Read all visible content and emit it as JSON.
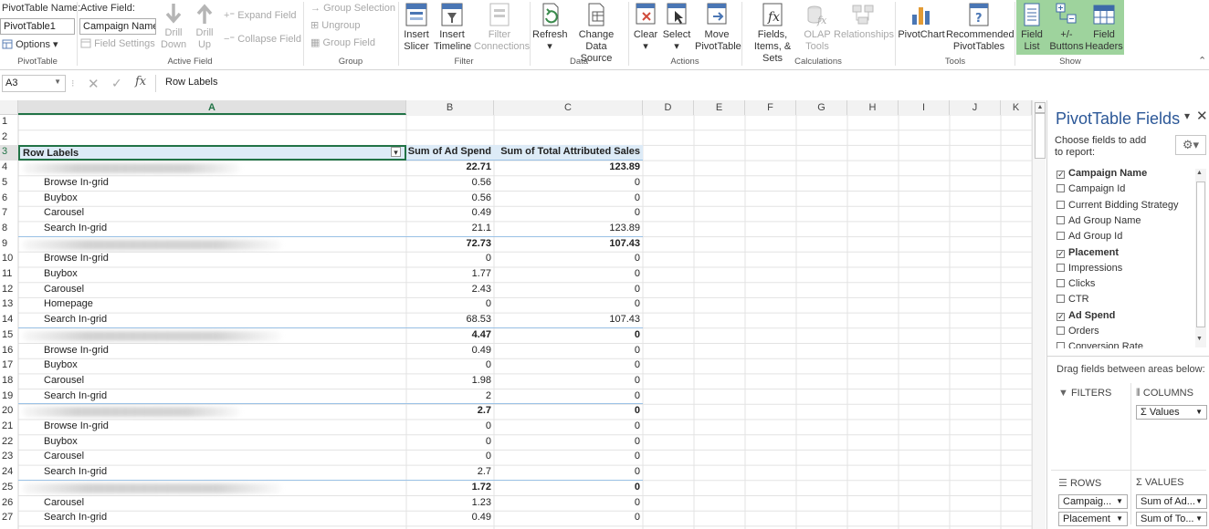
{
  "ribbon": {
    "pivottable_group": {
      "name_label": "PivotTable Name:",
      "name_value": "PivotTable1",
      "options_label": "Options",
      "group_name": "PivotTable"
    },
    "active_field_group": {
      "active_field_label": "Active Field:",
      "active_field_value": "Campaign Name",
      "field_settings_label": "Field Settings",
      "drill_down_label": "Drill Down",
      "drill_up_label": "Drill Up",
      "expand_field_label": "Expand Field",
      "collapse_field_label": "Collapse Field",
      "group_name": "Active Field"
    },
    "group_group": {
      "group_selection_label": "Group Selection",
      "ungroup_label": "Ungroup",
      "group_field_label": "Group Field",
      "group_name": "Group"
    },
    "filter_group": {
      "insert_slicer_label": "Insert Slicer",
      "insert_timeline_label": "Insert Timeline",
      "filter_connections_label": "Filter Connections",
      "group_name": "Filter"
    },
    "data_group": {
      "refresh_label": "Refresh",
      "change_data_source_label": "Change Data Source",
      "group_name": "Data"
    },
    "actions_group": {
      "clear_label": "Clear",
      "select_label": "Select",
      "move_pivottable_label": "Move PivotTable",
      "group_name": "Actions"
    },
    "calculations_group": {
      "fields_items_sets_label": "Fields, Items, & Sets",
      "olap_tools_label": "OLAP Tools",
      "relationships_label": "Relationships",
      "group_name": "Calculations"
    },
    "tools_group": {
      "pivotchart_label": "PivotChart",
      "recommended_pivottables_label": "Recommended PivotTables",
      "group_name": "Tools"
    },
    "show_group": {
      "field_list_label": "Field List",
      "buttons_label": "+/- Buttons",
      "field_headers_label": "Field Headers",
      "group_name": "Show",
      "active_color": "#9ed39d"
    }
  },
  "formula_bar": {
    "name_box": "A3",
    "content": "Row Labels",
    "fx_label": "fx"
  },
  "sheet": {
    "columns": [
      "A",
      "B",
      "C",
      "D",
      "E",
      "F",
      "G",
      "H",
      "I",
      "J",
      "K"
    ],
    "row_numbers": [
      "1",
      "2",
      "3",
      "4",
      "5",
      "6",
      "7",
      "8",
      "9",
      "10",
      "11",
      "12",
      "13",
      "14",
      "15",
      "16",
      "17",
      "18",
      "19",
      "20",
      "21",
      "22",
      "23",
      "24",
      "25",
      "26",
      "27"
    ],
    "header": {
      "row_labels": "Row Labels",
      "sum_ad_spend": "Sum of Ad Spend",
      "sum_attributed_sales": "Sum of Total Attributed Sales"
    },
    "rows": [
      {
        "label": "",
        "ad_spend": "22.71",
        "sales": "123.89",
        "kind": "group"
      },
      {
        "label": "Browse In-grid",
        "ad_spend": "0.56",
        "sales": "0",
        "kind": "item"
      },
      {
        "label": "Buybox",
        "ad_spend": "0.56",
        "sales": "0",
        "kind": "item"
      },
      {
        "label": "Carousel",
        "ad_spend": "0.49",
        "sales": "0",
        "kind": "item"
      },
      {
        "label": "Search In-grid",
        "ad_spend": "21.1",
        "sales": "123.89",
        "kind": "item"
      },
      {
        "label": "",
        "ad_spend": "72.73",
        "sales": "107.43",
        "kind": "group"
      },
      {
        "label": "Browse In-grid",
        "ad_spend": "0",
        "sales": "0",
        "kind": "item"
      },
      {
        "label": "Buybox",
        "ad_spend": "1.77",
        "sales": "0",
        "kind": "item"
      },
      {
        "label": "Carousel",
        "ad_spend": "2.43",
        "sales": "0",
        "kind": "item"
      },
      {
        "label": "Homepage",
        "ad_spend": "0",
        "sales": "0",
        "kind": "item"
      },
      {
        "label": "Search In-grid",
        "ad_spend": "68.53",
        "sales": "107.43",
        "kind": "item"
      },
      {
        "label": "",
        "ad_spend": "4.47",
        "sales": "0",
        "kind": "group"
      },
      {
        "label": "Browse In-grid",
        "ad_spend": "0.49",
        "sales": "0",
        "kind": "item"
      },
      {
        "label": "Buybox",
        "ad_spend": "0",
        "sales": "0",
        "kind": "item"
      },
      {
        "label": "Carousel",
        "ad_spend": "1.98",
        "sales": "0",
        "kind": "item"
      },
      {
        "label": "Search In-grid",
        "ad_spend": "2",
        "sales": "0",
        "kind": "item"
      },
      {
        "label": "",
        "ad_spend": "2.7",
        "sales": "0",
        "kind": "group"
      },
      {
        "label": "Browse In-grid",
        "ad_spend": "0",
        "sales": "0",
        "kind": "item"
      },
      {
        "label": "Buybox",
        "ad_spend": "0",
        "sales": "0",
        "kind": "item"
      },
      {
        "label": "Carousel",
        "ad_spend": "0",
        "sales": "0",
        "kind": "item"
      },
      {
        "label": "Search In-grid",
        "ad_spend": "2.7",
        "sales": "0",
        "kind": "item"
      },
      {
        "label": "",
        "ad_spend": "1.72",
        "sales": "0",
        "kind": "group"
      },
      {
        "label": "Carousel",
        "ad_spend": "1.23",
        "sales": "0",
        "kind": "item"
      },
      {
        "label": "Search In-grid",
        "ad_spend": "0.49",
        "sales": "0",
        "kind": "item"
      }
    ]
  },
  "field_pane": {
    "title": "PivotTable Fields",
    "subtitle": "Choose fields to add to report:",
    "fields": [
      {
        "name": "Campaign Name",
        "checked": true
      },
      {
        "name": "Campaign Id",
        "checked": false
      },
      {
        "name": "Current Bidding Strategy",
        "checked": false
      },
      {
        "name": "Ad Group Name",
        "checked": false
      },
      {
        "name": "Ad Group Id",
        "checked": false
      },
      {
        "name": "Placement",
        "checked": true
      },
      {
        "name": "Impressions",
        "checked": false
      },
      {
        "name": "Clicks",
        "checked": false
      },
      {
        "name": "CTR",
        "checked": false
      },
      {
        "name": "Ad Spend",
        "checked": true
      },
      {
        "name": "Orders",
        "checked": false
      },
      {
        "name": "Conversion Rate",
        "checked": false
      }
    ],
    "drag_hint": "Drag fields between areas below:",
    "filters_label": "FILTERS",
    "columns_label": "COLUMNS",
    "columns_items": [
      "Σ Values"
    ],
    "rows_label": "ROWS",
    "rows_items": [
      "Campaig...",
      "Placement"
    ],
    "values_label": "Σ VALUES",
    "values_items": [
      "Sum of Ad...",
      "Sum of To..."
    ]
  }
}
